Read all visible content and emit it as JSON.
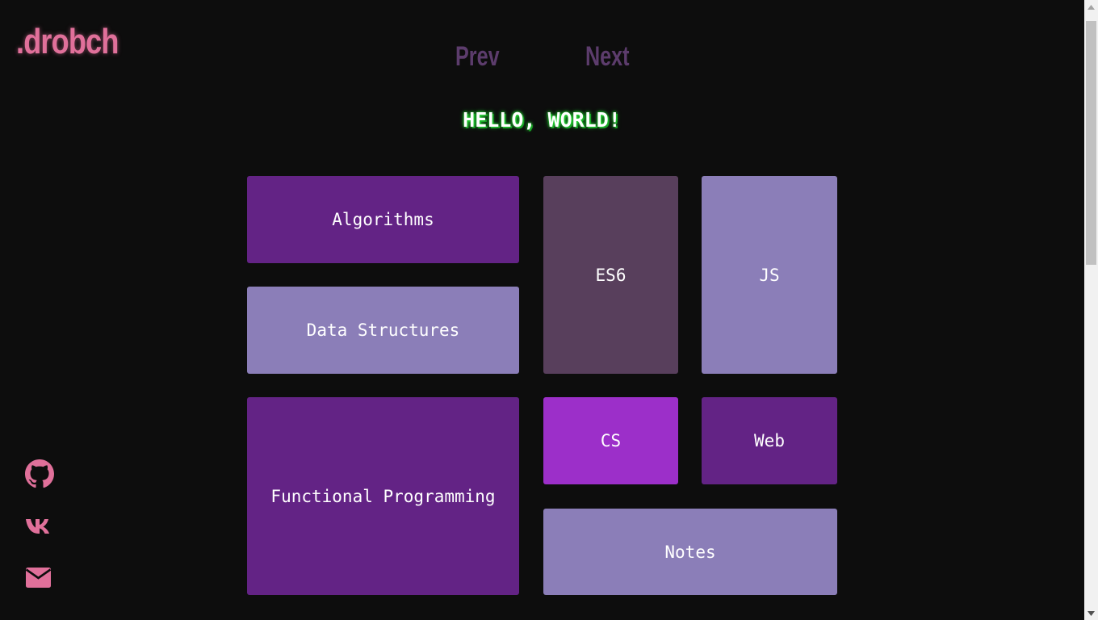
{
  "logo": ".drobch",
  "nav": {
    "prev_label": "Prev",
    "next_label": "Next"
  },
  "heading": "HELLO, WORLD!",
  "tiles": [
    {
      "label": "Algorithms",
      "color": "#632385"
    },
    {
      "label": "ES6",
      "color": "#583f5c"
    },
    {
      "label": "JS",
      "color": "#8b7eb8"
    },
    {
      "label": "Data Structures",
      "color": "#8b7eb8"
    },
    {
      "label": "Functional Programming",
      "color": "#632385"
    },
    {
      "label": "CS",
      "color": "#9c2fc9"
    },
    {
      "label": "Web",
      "color": "#632385"
    },
    {
      "label": "Notes",
      "color": "#8b7eb8"
    }
  ],
  "social": [
    {
      "icon": "github-icon"
    },
    {
      "icon": "vk-icon"
    },
    {
      "icon": "mail-icon"
    }
  ],
  "colors": {
    "background": "#0d0d0d",
    "accent_pink": "#e0709a",
    "nav": "#5c3c6c",
    "heading_glow": "#22dd33"
  }
}
